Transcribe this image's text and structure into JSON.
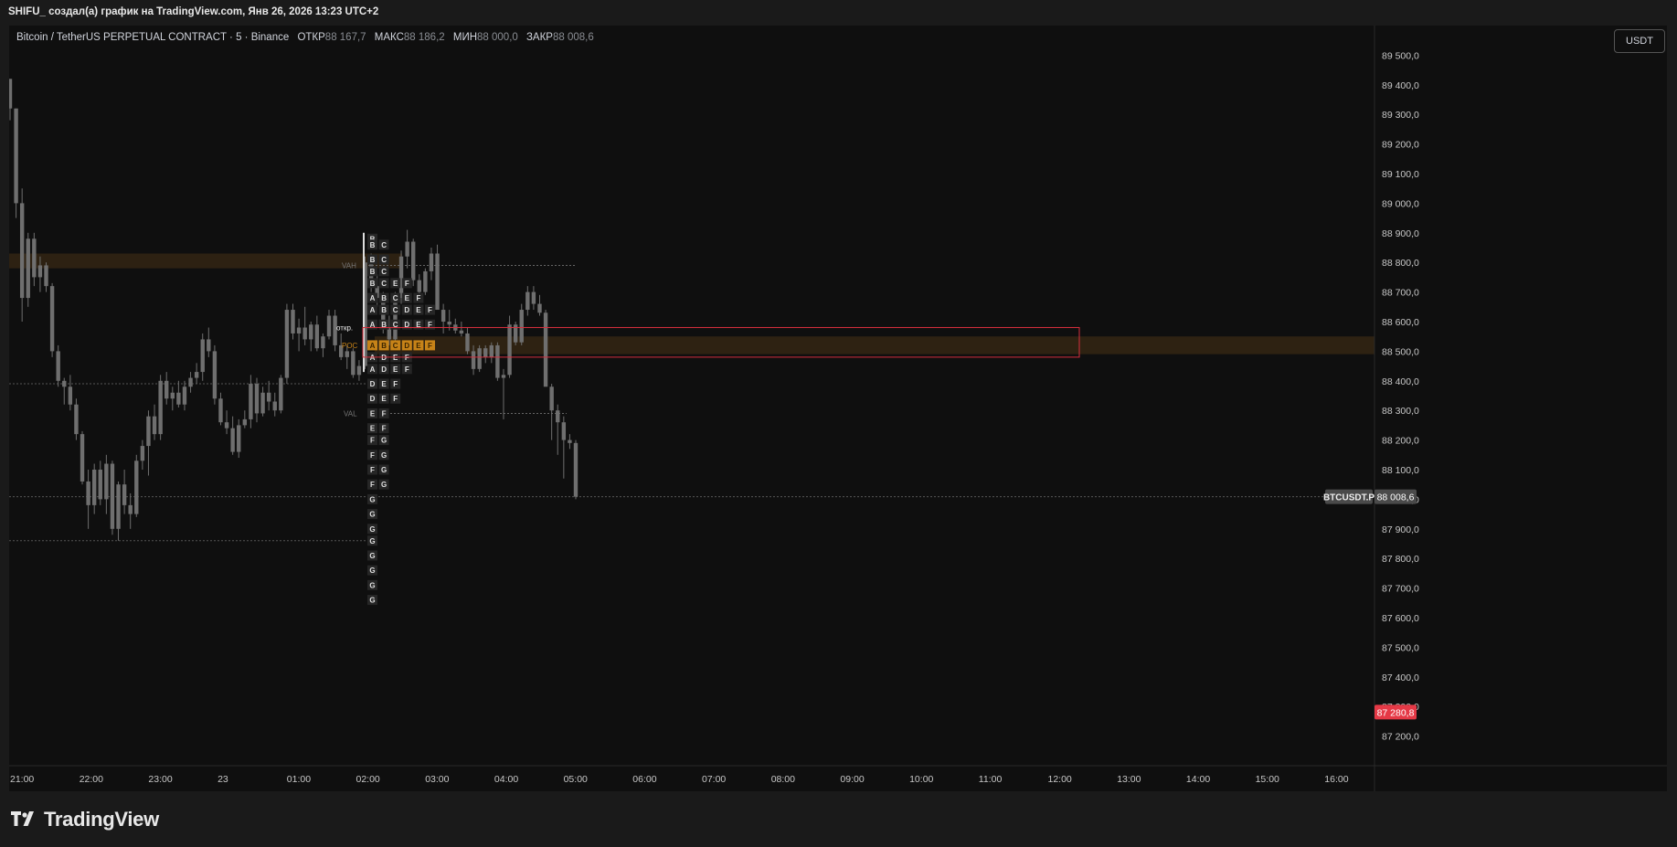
{
  "header": {
    "title": "SHIFU_ создал(а) график на TradingView.com, Янв 26, 2026 13:23 UTC+2"
  },
  "legend": {
    "symbol": "Bitcoin / TetherUS PERPETUAL CONTRACT · 5 · Binance",
    "open_label": "ОТКР",
    "open": "88 167,7",
    "high_label": "МАКС",
    "high": "88 186,2",
    "low_label": "МИН",
    "low": "88 000,0",
    "close_label": "ЗАКР",
    "close": "88 008,6"
  },
  "currency_button": "USDT",
  "footer": {
    "brand": "TradingView"
  },
  "colors": {
    "background": "#0f0f0f",
    "candle": "#6f6f6f",
    "poc_highlight": "#c78318",
    "price_tag": "#4a4a4a",
    "red_tag": "#e53946",
    "rect_outline": "#d62f3d",
    "band": "#3a2a14"
  },
  "chart_data": {
    "type": "candlestick",
    "symbol": "BTCUSDT.P",
    "ylim": [
      87100,
      89600
    ],
    "y_ticks": [
      {
        "value": 89500,
        "label": "89 500,0"
      },
      {
        "value": 89400,
        "label": "89 400,0"
      },
      {
        "value": 89300,
        "label": "89 300,0"
      },
      {
        "value": 89200,
        "label": "89 200,0"
      },
      {
        "value": 89100,
        "label": "89 100,0"
      },
      {
        "value": 89000,
        "label": "89 000,0"
      },
      {
        "value": 88900,
        "label": "88 900,0"
      },
      {
        "value": 88800,
        "label": "88 800,0"
      },
      {
        "value": 88700,
        "label": "88 700,0"
      },
      {
        "value": 88600,
        "label": "88 600,0"
      },
      {
        "value": 88500,
        "label": "88 500,0"
      },
      {
        "value": 88400,
        "label": "88 400,0"
      },
      {
        "value": 88300,
        "label": "88 300,0"
      },
      {
        "value": 88200,
        "label": "88 200,0"
      },
      {
        "value": 88100,
        "label": "88 100,0"
      },
      {
        "value": 88000,
        "label": "88 000,0"
      },
      {
        "value": 87900,
        "label": "87 900,0"
      },
      {
        "value": 87800,
        "label": "87 800,0"
      },
      {
        "value": 87700,
        "label": "87 700,0"
      },
      {
        "value": 87600,
        "label": "87 600,0"
      },
      {
        "value": 87500,
        "label": "87 500,0"
      },
      {
        "value": 87400,
        "label": "87 400,0"
      },
      {
        "value": 87300,
        "label": "87 300,0"
      },
      {
        "value": 87200,
        "label": "87 200,0"
      }
    ],
    "x_ticks": [
      "21:00",
      "22:00",
      "23:00",
      "23",
      "01:00",
      "02:00",
      "03:00",
      "04:00",
      "05:00",
      "06:00",
      "07:00",
      "08:00",
      "09:00",
      "10:00",
      "11:00",
      "12:00",
      "13:00",
      "14:00",
      "15:00",
      "16:00"
    ],
    "last_price": {
      "value": 88008.6,
      "label": "88 008,6",
      "ticker": "BTCUSDT.P"
    },
    "marker_price": {
      "value": 87280.8,
      "label": "87 280,8"
    },
    "candles": [
      [
        89420,
        89420,
        89280,
        89320
      ],
      [
        89320,
        89320,
        88950,
        89000
      ],
      [
        89000,
        89050,
        88600,
        88680
      ],
      [
        88680,
        88900,
        88650,
        88880
      ],
      [
        88880,
        88900,
        88720,
        88750
      ],
      [
        88750,
        88820,
        88700,
        88790
      ],
      [
        88790,
        88800,
        88700,
        88720
      ],
      [
        88720,
        88730,
        88480,
        88500
      ],
      [
        88500,
        88520,
        88380,
        88400
      ],
      [
        88400,
        88410,
        88320,
        88380
      ],
      [
        88380,
        88420,
        88300,
        88320
      ],
      [
        88320,
        88340,
        88200,
        88220
      ],
      [
        88220,
        88230,
        88050,
        88060
      ],
      [
        88060,
        88100,
        87900,
        87980
      ],
      [
        87980,
        88120,
        87950,
        88100
      ],
      [
        88100,
        88130,
        87980,
        88000
      ],
      [
        88000,
        88150,
        87950,
        88120
      ],
      [
        88120,
        88130,
        87880,
        87900
      ],
      [
        87900,
        88060,
        87860,
        88050
      ],
      [
        88050,
        88100,
        87950,
        87980
      ],
      [
        87980,
        88020,
        87900,
        87950
      ],
      [
        87950,
        88150,
        87940,
        88130
      ],
      [
        88130,
        88200,
        88100,
        88180
      ],
      [
        88180,
        88300,
        88080,
        88280
      ],
      [
        88280,
        88320,
        88200,
        88220
      ],
      [
        88220,
        88420,
        88200,
        88400
      ],
      [
        88400,
        88430,
        88320,
        88340
      ],
      [
        88340,
        88380,
        88300,
        88360
      ],
      [
        88360,
        88400,
        88310,
        88320
      ],
      [
        88320,
        88400,
        88300,
        88380
      ],
      [
        88380,
        88430,
        88360,
        88410
      ],
      [
        88410,
        88460,
        88390,
        88430
      ],
      [
        88430,
        88560,
        88400,
        88540
      ],
      [
        88540,
        88580,
        88480,
        88500
      ],
      [
        88500,
        88520,
        88320,
        88340
      ],
      [
        88340,
        88360,
        88250,
        88260
      ],
      [
        88260,
        88300,
        88220,
        88240
      ],
      [
        88240,
        88280,
        88150,
        88160
      ],
      [
        88160,
        88270,
        88140,
        88250
      ],
      [
        88250,
        88300,
        88240,
        88270
      ],
      [
        88270,
        88420,
        88240,
        88390
      ],
      [
        88390,
        88410,
        88260,
        88290
      ],
      [
        88290,
        88380,
        88280,
        88360
      ],
      [
        88360,
        88400,
        88300,
        88330
      ],
      [
        88330,
        88360,
        88280,
        88300
      ],
      [
        88300,
        88420,
        88290,
        88410
      ],
      [
        88410,
        88660,
        88390,
        88640
      ],
      [
        88640,
        88660,
        88540,
        88560
      ],
      [
        88560,
        88610,
        88500,
        88580
      ],
      [
        88580,
        88650,
        88520,
        88540
      ],
      [
        88540,
        88600,
        88500,
        88590
      ],
      [
        88590,
        88620,
        88500,
        88510
      ],
      [
        88510,
        88560,
        88480,
        88550
      ],
      [
        88550,
        88640,
        88540,
        88620
      ],
      [
        88620,
        88640,
        88500,
        88520
      ],
      [
        88520,
        88560,
        88470,
        88480
      ],
      [
        88480,
        88520,
        88440,
        88500
      ],
      [
        88500,
        88510,
        88410,
        88420
      ],
      [
        88420,
        88470,
        88400,
        88450
      ],
      [
        88450,
        88820,
        88440,
        88800
      ],
      [
        88800,
        88830,
        88700,
        88720
      ],
      [
        88720,
        88760,
        88650,
        88680
      ],
      [
        88680,
        88700,
        88560,
        88580
      ],
      [
        88580,
        88620,
        88520,
        88540
      ],
      [
        88540,
        88700,
        88530,
        88680
      ],
      [
        88680,
        88840,
        88660,
        88820
      ],
      [
        88820,
        88910,
        88780,
        88870
      ],
      [
        88870,
        88880,
        88720,
        88740
      ],
      [
        88740,
        88760,
        88680,
        88700
      ],
      [
        88700,
        88780,
        88690,
        88770
      ],
      [
        88770,
        88850,
        88740,
        88830
      ],
      [
        88830,
        88860,
        88700,
        88640
      ],
      [
        88640,
        88660,
        88560,
        88600
      ],
      [
        88600,
        88640,
        88570,
        88590
      ],
      [
        88590,
        88610,
        88560,
        88570
      ],
      [
        88570,
        88600,
        88550,
        88560
      ],
      [
        88560,
        88580,
        88490,
        88500
      ],
      [
        88500,
        88520,
        88420,
        88440
      ],
      [
        88440,
        88520,
        88430,
        88510
      ],
      [
        88510,
        88520,
        88460,
        88480
      ],
      [
        88480,
        88530,
        88460,
        88520
      ],
      [
        88520,
        88530,
        88400,
        88410
      ],
      [
        88410,
        88440,
        88270,
        88420
      ],
      [
        88420,
        88620,
        88410,
        88590
      ],
      [
        88590,
        88600,
        88520,
        88530
      ],
      [
        88530,
        88660,
        88520,
        88640
      ],
      [
        88640,
        88720,
        88620,
        88700
      ],
      [
        88700,
        88720,
        88640,
        88660
      ],
      [
        88660,
        88690,
        88620,
        88630
      ],
      [
        88630,
        88640,
        88420,
        88380
      ],
      [
        88380,
        88390,
        88200,
        88300
      ],
      [
        88300,
        88320,
        88150,
        88260
      ],
      [
        88260,
        88280,
        88070,
        88200
      ],
      [
        88200,
        88220,
        88170,
        88190
      ],
      [
        88190,
        88200,
        88000,
        88008.6
      ]
    ],
    "market_profile": {
      "vah": 88790,
      "val": 88290,
      "poc": 88520,
      "vah_label": "VAH",
      "val_label": "VAL",
      "poc_label": "POC",
      "open_label": "откр.",
      "rows": [
        {
          "price": 88880,
          "letters": [
            "B"
          ]
        },
        {
          "price": 88860,
          "letters": [
            "B",
            "C"
          ]
        },
        {
          "price": 88810,
          "letters": [
            "B",
            "C"
          ]
        },
        {
          "price": 88770,
          "letters": [
            "B",
            "C"
          ]
        },
        {
          "price": 88730,
          "letters": [
            "B",
            "C",
            "E",
            "F"
          ]
        },
        {
          "price": 88680,
          "letters": [
            "A",
            "B",
            "C",
            "E",
            "F"
          ]
        },
        {
          "price": 88640,
          "letters": [
            "A",
            "B",
            "C",
            "D",
            "E",
            "F"
          ]
        },
        {
          "price": 88590,
          "letters": [
            "A",
            "B",
            "C",
            "D",
            "E",
            "F"
          ]
        },
        {
          "price": 88520,
          "letters": [
            "A",
            "B",
            "C",
            "D",
            "E",
            "F"
          ]
        },
        {
          "price": 88480,
          "letters": [
            "A",
            "D",
            "E",
            "F"
          ]
        },
        {
          "price": 88440,
          "letters": [
            "A",
            "D",
            "E",
            "F"
          ]
        },
        {
          "price": 88390,
          "letters": [
            "D",
            "E",
            "F"
          ]
        },
        {
          "price": 88340,
          "letters": [
            "D",
            "E",
            "F"
          ]
        },
        {
          "price": 88290,
          "letters": [
            "E",
            "F"
          ]
        },
        {
          "price": 88240,
          "letters": [
            "E",
            "F"
          ]
        },
        {
          "price": 88200,
          "letters": [
            "F",
            "G"
          ]
        },
        {
          "price": 88150,
          "letters": [
            "F",
            "G"
          ]
        },
        {
          "price": 88100,
          "letters": [
            "F",
            "G"
          ]
        },
        {
          "price": 88050,
          "letters": [
            "F",
            "G"
          ]
        },
        {
          "price": 88000,
          "letters": [
            "G"
          ]
        },
        {
          "price": 87950,
          "letters": [
            "G"
          ]
        },
        {
          "price": 87900,
          "letters": [
            "G"
          ]
        },
        {
          "price": 87860,
          "letters": [
            "G"
          ]
        },
        {
          "price": 87810,
          "letters": [
            "G"
          ]
        },
        {
          "price": 87760,
          "letters": [
            "G"
          ]
        },
        {
          "price": 87710,
          "letters": [
            "G"
          ]
        },
        {
          "price": 87660,
          "letters": [
            "G"
          ]
        }
      ]
    },
    "horizontal_dotted_lines": [
      88390,
      87860
    ],
    "highlight_band": [
      88490,
      88550
    ],
    "old_band": [
      88780,
      88830
    ]
  }
}
